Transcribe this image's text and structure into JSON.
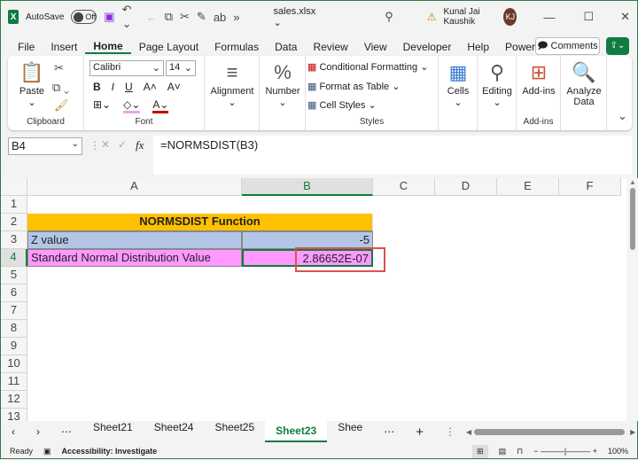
{
  "titlebar": {
    "autosave": "AutoSave",
    "toggle": "Off",
    "filename": "sales.xlsx ⌄",
    "user": "Kunal Jai Kaushik",
    "initials": "KJ"
  },
  "menu": [
    "File",
    "Insert",
    "Home",
    "Page Layout",
    "Formulas",
    "Data",
    "Review",
    "View",
    "Developer",
    "Help",
    "Power Pivot"
  ],
  "menu_active": "Home",
  "comments": "Comments",
  "ribbon": {
    "paste": "Paste",
    "clipboard": "Clipboard",
    "font_name": "Calibri",
    "font_size": "14",
    "font": "Font",
    "bold": "B",
    "italic": "I",
    "underline": "U",
    "alignment": "Alignment",
    "number": "Number",
    "cond_fmt": "Conditional Formatting",
    "fmt_table": "Format as Table",
    "cell_styles": "Cell Styles",
    "styles": "Styles",
    "cells": "Cells",
    "editing": "Editing",
    "addins": "Add-ins",
    "addins_group": "Add-ins",
    "analyze": "Analyze Data"
  },
  "formula_bar": {
    "name_box": "B4",
    "formula": "=NORMSDIST(B3)",
    "fx": "fx"
  },
  "columns": [
    "A",
    "B",
    "C",
    "D",
    "E",
    "F"
  ],
  "rows": [
    "1",
    "2",
    "3",
    "4",
    "5",
    "6",
    "7",
    "8",
    "9",
    "10",
    "11",
    "12",
    "13"
  ],
  "cells": {
    "title": "NORMSDIST Function",
    "a3": "Z value",
    "b3": "-5",
    "a4": "Standard Normal Distribution Value",
    "b4": "2.86652E-07"
  },
  "colors": {
    "header_fill": "#ffc000",
    "z_fill": "#b4c6e7",
    "result_fill": "#ff99ff",
    "accent": "#107c41",
    "highlight": "#e05050"
  },
  "sheets": [
    "Sheet21",
    "Sheet24",
    "Sheet25",
    "Sheet23",
    "Shee"
  ],
  "active_sheet": "Sheet23",
  "status": {
    "ready": "Ready",
    "accessibility": "Accessibility: Investigate",
    "zoom": "100%"
  }
}
